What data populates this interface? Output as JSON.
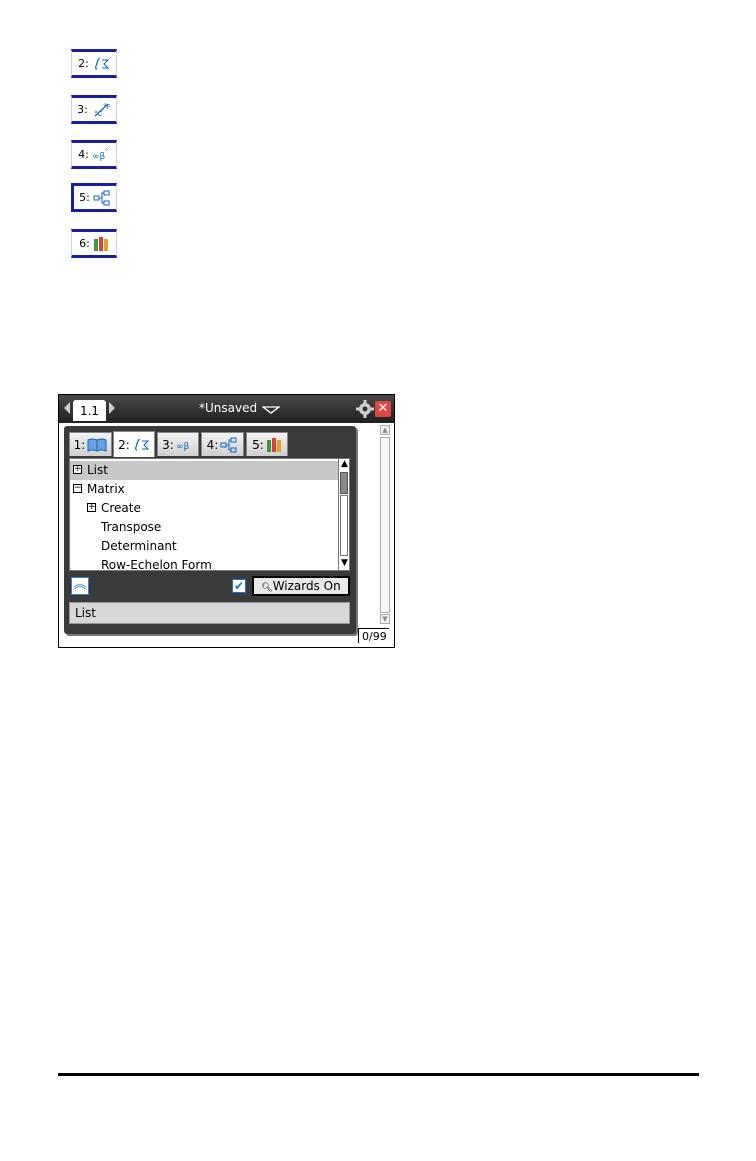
{
  "key_icons": [
    {
      "label": "2:",
      "icon": "integral-sigma-icon"
    },
    {
      "label": "3:",
      "icon": "conversion-icon"
    },
    {
      "label": "4:",
      "icon": "infinity-beta-icon"
    },
    {
      "label": "5:",
      "icon": "library-tree-icon"
    },
    {
      "label": "6:",
      "icon": "books-icon"
    }
  ],
  "device": {
    "page_tab": "1.1",
    "doc_title": "*Unsaved",
    "history_count": "0/99"
  },
  "catalog": {
    "tabs": [
      {
        "label": "1:",
        "icon": "book-icon"
      },
      {
        "label": "2:",
        "icon": "integral-sigma-icon"
      },
      {
        "label": "3:",
        "icon": "infinity-beta-icon"
      },
      {
        "label": "4:",
        "icon": "library-tree-icon"
      },
      {
        "label": "5:",
        "icon": "books-icon"
      }
    ],
    "active_tab": 1,
    "items": [
      {
        "label": "List",
        "expander": "+"
      },
      {
        "label": "Matrix",
        "expander": "−"
      },
      {
        "label": "Create",
        "expander": "+"
      },
      {
        "label": "Transpose",
        "expander": ""
      },
      {
        "label": "Determinant",
        "expander": ""
      },
      {
        "label": "Row-Echelon Form",
        "expander": ""
      }
    ],
    "selected_item": "List",
    "wizards_checked": true,
    "wizards_label": "Wizards On",
    "status_text": "List"
  }
}
